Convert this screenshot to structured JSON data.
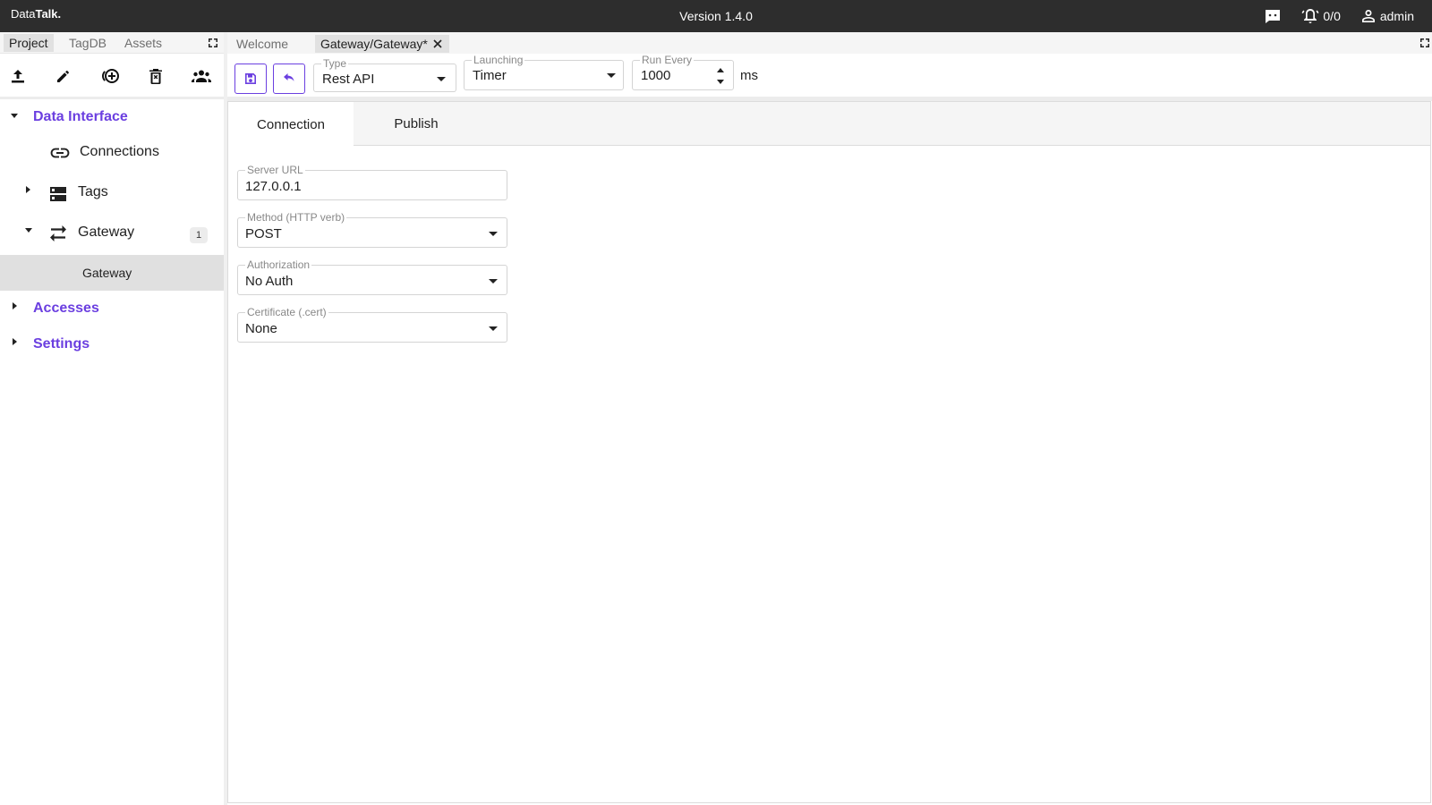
{
  "app": {
    "brand_prefix": "Data",
    "brand_bold": "Talk.",
    "version": "Version 1.4.0",
    "alarms": "0/0",
    "user": "admin",
    "icons": [
      "chat-icon",
      "alarm-bell-icon",
      "user-icon"
    ]
  },
  "left_panel": {
    "tabs": [
      {
        "label": "Project",
        "active": true
      },
      {
        "label": "TagDB",
        "active": false
      },
      {
        "label": "Assets",
        "active": false
      }
    ],
    "toolbar_icons": [
      "upload-icon",
      "edit-icon",
      "add-circle-icon",
      "delete-icon",
      "users-icon"
    ],
    "tree": {
      "data_interface": "Data Interface",
      "connections": "Connections",
      "tags": "Tags",
      "gateway": "Gateway",
      "gateway_count": "1",
      "gateway_child": "Gateway",
      "accesses": "Accesses",
      "settings": "Settings"
    }
  },
  "editor": {
    "tabs": [
      {
        "label": "Welcome",
        "active": false
      },
      {
        "label": "Gateway/Gateway*",
        "active": true
      }
    ],
    "toolbar": {
      "type_label": "Type",
      "type_value": "Rest API",
      "launching_label": "Launching",
      "launching_value": "Timer",
      "run_every_label": "Run Every",
      "run_every_value": "1000",
      "run_every_unit": "ms",
      "icons": [
        "save-icon",
        "undo-icon"
      ]
    },
    "content_tabs": [
      {
        "label": "Connection",
        "active": true
      },
      {
        "label": "Publish",
        "active": false
      }
    ],
    "form": {
      "server_url_label": "Server URL",
      "server_url_value": "127.0.0.1",
      "method_label": "Method (HTTP verb)",
      "method_value": "POST",
      "auth_label": "Authorization",
      "auth_value": "No Auth",
      "cert_label": "Certificate (.cert)",
      "cert_value": "None"
    }
  },
  "colors": {
    "topbar": "#2d2d2d",
    "accent": "#6b3fe0",
    "panel_bg": "#f5f5f5",
    "selected_row": "#e0e0e0"
  }
}
